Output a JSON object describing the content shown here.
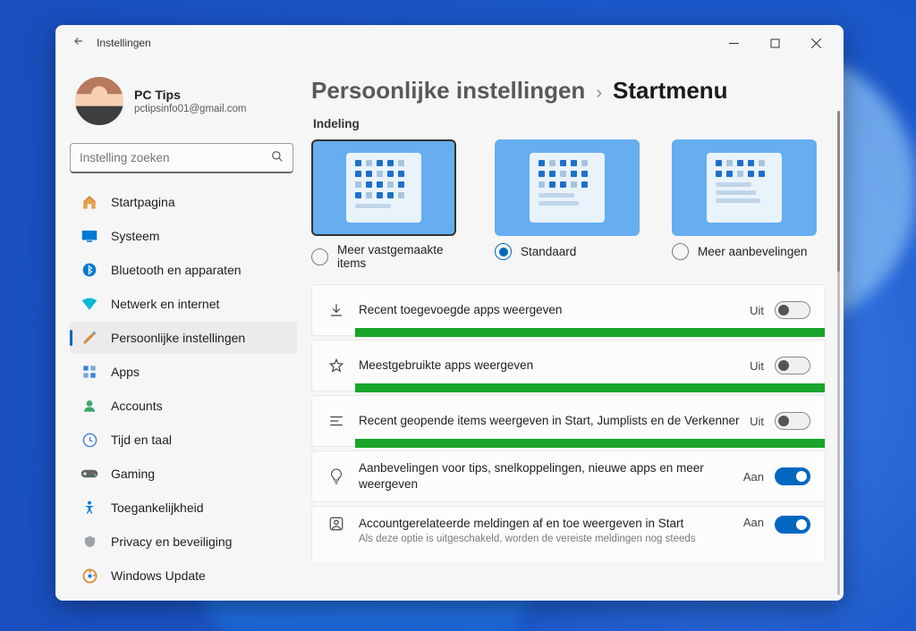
{
  "window": {
    "title": "Instellingen"
  },
  "profile": {
    "name": "PC Tips",
    "email": "pctipsinfo01@gmail.com"
  },
  "search": {
    "placeholder": "Instelling zoeken"
  },
  "nav": {
    "items": [
      {
        "label": "Startpagina",
        "icon": "home"
      },
      {
        "label": "Systeem",
        "icon": "system"
      },
      {
        "label": "Bluetooth en apparaten",
        "icon": "bluetooth"
      },
      {
        "label": "Netwerk en internet",
        "icon": "network"
      },
      {
        "label": "Persoonlijke instellingen",
        "icon": "personalize",
        "active": true
      },
      {
        "label": "Apps",
        "icon": "apps"
      },
      {
        "label": "Accounts",
        "icon": "accounts"
      },
      {
        "label": "Tijd en taal",
        "icon": "time"
      },
      {
        "label": "Gaming",
        "icon": "gaming"
      },
      {
        "label": "Toegankelijkheid",
        "icon": "accessibility"
      },
      {
        "label": "Privacy en beveiliging",
        "icon": "privacy"
      },
      {
        "label": "Windows Update",
        "icon": "update"
      }
    ]
  },
  "breadcrumb": {
    "parent": "Persoonlijke instellingen",
    "current": "Startmenu"
  },
  "section": {
    "layout_label": "Indeling"
  },
  "layout_options": [
    {
      "label": "Meer vastgemaakte items",
      "selected": false
    },
    {
      "label": "Standaard",
      "selected": true
    },
    {
      "label": "Meer aanbevelingen",
      "selected": false
    }
  ],
  "settings": [
    {
      "icon": "download",
      "title": "Recent toegevoegde apps weergeven",
      "state": "Uit",
      "on": false,
      "highlight": true
    },
    {
      "icon": "star",
      "title": "Meestgebruikte apps weergeven",
      "state": "Uit",
      "on": false,
      "highlight": true
    },
    {
      "icon": "list",
      "title": "Recent geopende items weergeven in Start, Jumplists en de Verkenner",
      "state": "Uit",
      "on": false,
      "highlight": true
    },
    {
      "icon": "bulb",
      "title": "Aanbevelingen voor tips, snelkoppelingen, nieuwe apps en meer weergeven",
      "state": "Aan",
      "on": true,
      "highlight": false
    },
    {
      "icon": "account",
      "title": "Accountgerelateerde meldingen af en toe weergeven in Start",
      "sub": "Als deze optie is uitgeschakeld, worden de vereiste meldingen nog steeds",
      "state": "Aan",
      "on": true,
      "highlight": false
    }
  ]
}
